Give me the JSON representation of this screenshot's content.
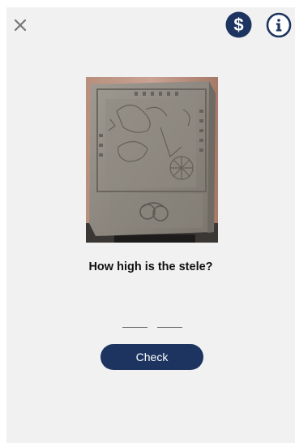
{
  "header": {
    "close_icon": "close-icon",
    "coin_icon": "dollar-coin-icon",
    "info_icon": "info-icon",
    "accent_color": "#1d3461"
  },
  "quiz": {
    "image": "stone-stele-photo",
    "question": "How high is the stele?",
    "answer_blanks": 2,
    "check_label": "Check"
  }
}
